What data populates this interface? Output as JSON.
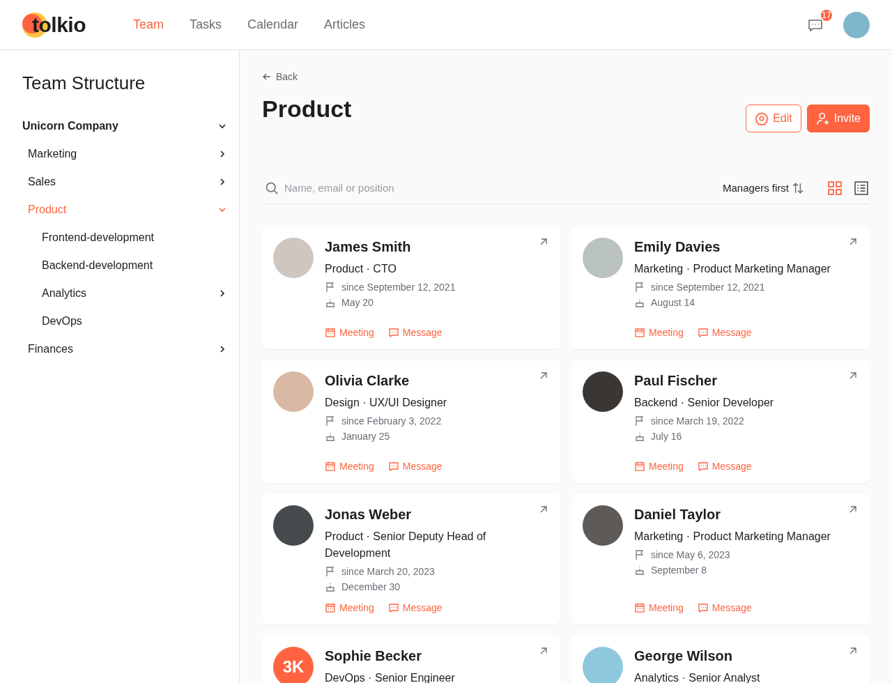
{
  "header": {
    "logo": "tolkio",
    "nav": [
      {
        "label": "Team",
        "selected": true
      },
      {
        "label": "Tasks",
        "selected": false
      },
      {
        "label": "Calendar",
        "selected": false
      },
      {
        "label": "Articles",
        "selected": false
      }
    ],
    "notifications": "17"
  },
  "sidebar": {
    "title": "Team Structure",
    "tree": [
      {
        "label": "Unicorn Company",
        "expandable": true,
        "expanded": true,
        "selected": false,
        "children": [
          {
            "label": "Marketing",
            "expandable": true,
            "expanded": false,
            "selected": false
          },
          {
            "label": "Sales",
            "expandable": true,
            "expanded": false,
            "selected": false
          },
          {
            "label": "Product",
            "expandable": true,
            "expanded": true,
            "selected": true,
            "children": [
              {
                "label": "Frontend-development",
                "expandable": false,
                "expanded": false,
                "selected": false
              },
              {
                "label": "Backend-development",
                "expandable": false,
                "expanded": false,
                "selected": false
              },
              {
                "label": "Analytics",
                "expandable": true,
                "expanded": false,
                "selected": false
              },
              {
                "label": "DevOps",
                "expandable": false,
                "expanded": false,
                "selected": false
              }
            ]
          },
          {
            "label": "Finances",
            "expandable": true,
            "expanded": false,
            "selected": false
          }
        ]
      }
    ]
  },
  "main": {
    "back": "Back",
    "title": "Product",
    "buttons": [
      {
        "label": "Edit",
        "kind": "outline"
      },
      {
        "label": "Invite",
        "kind": "primary"
      }
    ],
    "search": {
      "placeholder": "Name, email or position"
    },
    "sort": "Managers first",
    "view": [
      {
        "kind": "grid",
        "selected": true
      },
      {
        "kind": "list",
        "selected": false
      }
    ],
    "people": [
      {
        "name": "James Smith",
        "role": "Product · CTO",
        "since": "since September 12, 2021",
        "birthday": "May 20",
        "avatar": {
          "kind": "photo",
          "color": "#cfc6c0"
        },
        "actions": [
          "Meeting",
          "Message"
        ]
      },
      {
        "name": "Emily Davies",
        "role": "Marketing · Product Marketing Manager",
        "since": "since September 12, 2021",
        "birthday": "August 14",
        "avatar": {
          "kind": "photo",
          "color": "#b9c2bd"
        },
        "actions": [
          "Meeting",
          "Message"
        ]
      },
      {
        "name": "Olivia Clarke",
        "role": "Design · UX/UI Designer",
        "since": "since February 3, 2022",
        "birthday": "January 25",
        "avatar": {
          "kind": "photo",
          "color": "#d9b8a4"
        },
        "actions": [
          "Meeting",
          "Message"
        ]
      },
      {
        "name": "Paul Fischer",
        "role": "Backend · Senior Developer",
        "since": "since March 19, 2022",
        "birthday": "July 16",
        "avatar": {
          "kind": "photo",
          "color": "#3a3634"
        },
        "actions": [
          "Meeting",
          "Message"
        ]
      },
      {
        "name": "Jonas Weber",
        "role": "Product · Senior Deputy Head of Development",
        "since": "since March 20, 2023",
        "birthday": "December 30",
        "avatar": {
          "kind": "photo",
          "color": "#454a4c"
        },
        "actions": [
          "Meeting",
          "Message"
        ]
      },
      {
        "name": "Daniel Taylor",
        "role": "Marketing · Product Marketing Manager",
        "since": "since May 6, 2023",
        "birthday": "September 8",
        "avatar": {
          "kind": "photo",
          "color": "#5d5a57"
        },
        "actions": [
          "Meeting",
          "Message"
        ]
      },
      {
        "name": "Sophie Becker",
        "role": "DevOps · Senior Engineer",
        "avatar": {
          "kind": "initials",
          "text": "3K",
          "color": "#ff6340"
        }
      },
      {
        "name": "George Wilson",
        "role": "Analytics · Senior Analyst",
        "avatar": {
          "kind": "photo",
          "color": "#8fc8de"
        }
      }
    ]
  }
}
